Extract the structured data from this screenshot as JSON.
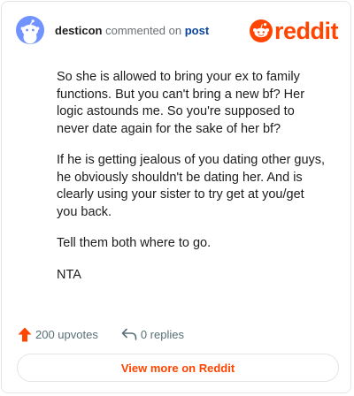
{
  "header": {
    "author": "desticon",
    "action": "commented on",
    "target": "post",
    "brand": "reddit"
  },
  "comment": {
    "paragraphs": [
      "So she is allowed to bring your ex to family functions. But you can't bring a new bf? Her logic astounds me. So you're supposed to never date again for the sake of her bf?",
      "If he is getting jealous of you dating other guys, he obviously shouldn't be dating her. And is clearly using your sister to try get at you/get you back.",
      "Tell them both where to go.",
      "NTA"
    ]
  },
  "footer": {
    "upvotes": "200 upvotes",
    "replies": "0 replies"
  },
  "cta": {
    "label": "View more on Reddit"
  },
  "colors": {
    "brand": "#ff4500",
    "avatar": "#7193ff",
    "link": "#0a449b"
  },
  "icons": {
    "avatar": "snoo-avatar-icon",
    "brand": "reddit-snoo-icon",
    "upvote": "upvote-arrow-icon",
    "reply": "reply-arrow-icon"
  }
}
